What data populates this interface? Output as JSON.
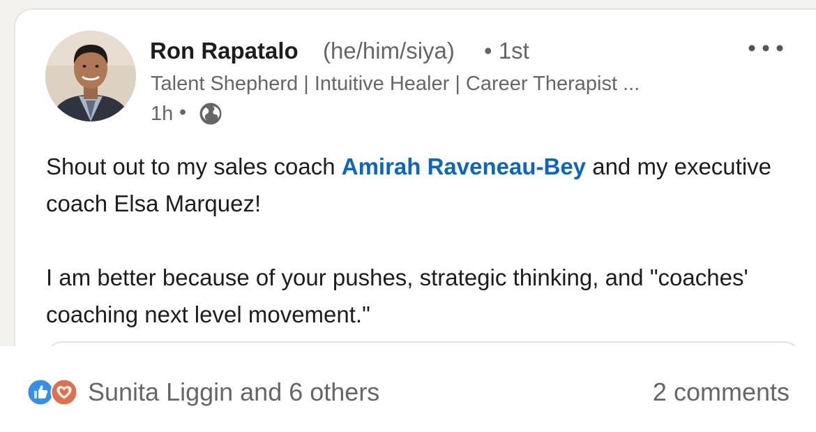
{
  "post": {
    "author": {
      "name": "Ron Rapatalo",
      "pronouns": "(he/him/siya)",
      "degree": "• 1st",
      "headline": "Talent Shepherd | Intuitive Healer | Career Therapist ...",
      "avatar_icon": "profile-photo"
    },
    "meta": {
      "time": "1h",
      "separator": "•",
      "visibility_icon": "globe-icon"
    },
    "menu_icon": "more-horizontal-icon",
    "body": {
      "p1_before": "Shout out to my sales coach ",
      "mention": "Amirah Raveneau-Bey",
      "p1_after": " and my executive coach Elsa Marquez!",
      "p2": "I am better because of your pushes, strategic thinking, and \"coaches' coaching next level movement.\""
    },
    "social": {
      "reaction_icons": [
        "like-icon",
        "love-icon"
      ],
      "reactors": "Sunita Liggin and 6 others",
      "comments": "2 comments"
    }
  },
  "colors": {
    "mention": "#0a66c2",
    "secondary_text": "#666666",
    "primary_text": "#1d1d1d",
    "like": "#378fe9",
    "love": "#df704d",
    "page_background": "#f4f2ee"
  }
}
